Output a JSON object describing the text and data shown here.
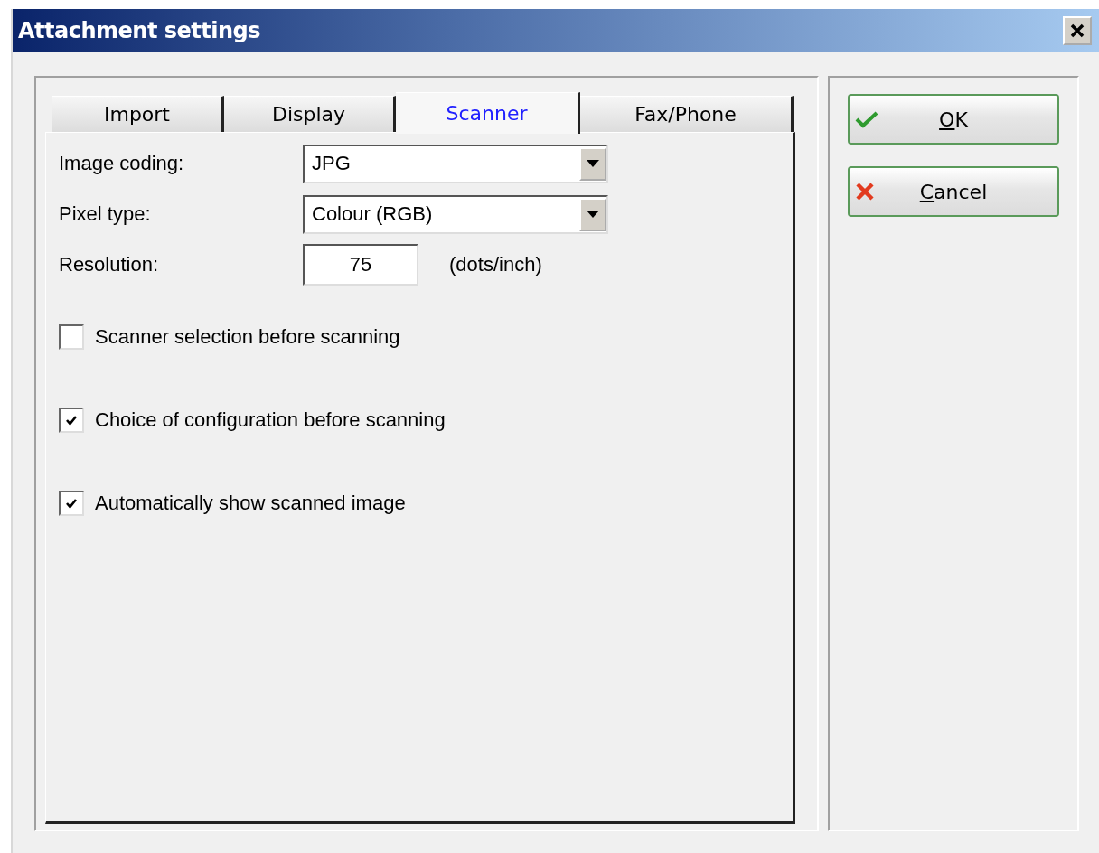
{
  "window": {
    "title": "Attachment settings"
  },
  "tabs": [
    {
      "label": "Import",
      "selected": false
    },
    {
      "label": "Display",
      "selected": false
    },
    {
      "label": "Scanner",
      "selected": true
    },
    {
      "label": "Fax/Phone",
      "selected": false
    }
  ],
  "fields": [
    {
      "kind": "dropdown",
      "label": "Image coding:",
      "value": "JPG"
    },
    {
      "kind": "dropdown",
      "label": "Pixel type:",
      "value": "Colour (RGB)"
    },
    {
      "kind": "number",
      "label": "Resolution:",
      "value": "75",
      "unit": "(dots/inch)"
    }
  ],
  "checkboxes": [
    {
      "label": "Scanner selection before scanning",
      "checked": false
    },
    {
      "label": "Choice of configuration before scanning",
      "checked": true
    },
    {
      "label": "Automatically show scanned image",
      "checked": true
    }
  ],
  "buttons": [
    {
      "kind": "ok",
      "label": "OK"
    },
    {
      "kind": "cancel",
      "label": "Cancel"
    }
  ]
}
